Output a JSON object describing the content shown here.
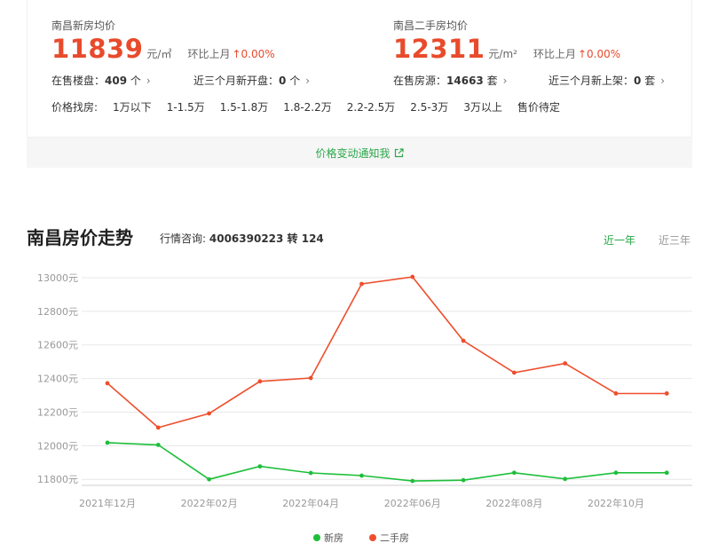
{
  "new_home": {
    "title": "南昌新房均价",
    "price": "11839",
    "unit": "元/㎡",
    "mom_label": "环比上月",
    "mom_value": "↑0.00%",
    "stat1_label": "在售楼盘：",
    "stat1_value": "409",
    "stat1_unit": "个",
    "stat2_label": "近三个月新开盘：",
    "stat2_value": "0",
    "stat2_unit": "个"
  },
  "second_hand": {
    "title": "南昌二手房均价",
    "price": "12311",
    "unit": "元/m²",
    "mom_label": "环比上月",
    "mom_value": "↑0.00%",
    "stat1_label": "在售房源：",
    "stat1_value": "14663",
    "stat1_unit": "套",
    "stat2_label": "近三个月新上架：",
    "stat2_value": "0",
    "stat2_unit": "套"
  },
  "price_filter": {
    "label": "价格找房:",
    "options": [
      "1万以下",
      "1-1.5万",
      "1.5-1.8万",
      "1.8-2.2万",
      "2.2-2.5万",
      "2.5-3万",
      "3万以上",
      "售价待定"
    ]
  },
  "notify": {
    "label": "价格变动通知我"
  },
  "trend": {
    "title": "南昌房价走势",
    "consult_label": "行情咨询:",
    "consult_phone": "4006390223 转 124",
    "tabs": [
      "近一年",
      "近三年"
    ]
  },
  "colors": {
    "accent_green": "#2aa84a",
    "accent_red": "#e84b2c",
    "new_line": "#1dbf3a",
    "second_line": "#ee4e2d"
  },
  "chart_data": {
    "type": "line",
    "x": [
      "2021年12月",
      "2022年01月",
      "2022年02月",
      "2022年03月",
      "2022年04月",
      "2022年05月",
      "2022年06月",
      "2022年07月",
      "2022年08月",
      "2022年09月",
      "2022年10月",
      "2022年11月"
    ],
    "x_tick_labels": [
      "2021年12月",
      "2022年02月",
      "2022年04月",
      "2022年06月",
      "2022年08月",
      "2022年10月"
    ],
    "y_tick_labels": [
      "11800元",
      "12000元",
      "12200元",
      "12400元",
      "12600元",
      "12800元",
      "13000元"
    ],
    "ylim": [
      11780,
      13000
    ],
    "series": [
      {
        "name": "新房",
        "color": "#1dbf3a",
        "values": [
          12018,
          12005,
          11800,
          11877,
          11838,
          11822,
          11790,
          11795,
          11839,
          11802,
          11839,
          11839
        ]
      },
      {
        "name": "二手房",
        "color": "#ee4e2d",
        "values": [
          12372,
          12108,
          12192,
          12383,
          12403,
          12963,
          13005,
          12625,
          12435,
          12490,
          12311,
          12311
        ]
      }
    ],
    "grid": true,
    "legend": "bottom-center"
  }
}
